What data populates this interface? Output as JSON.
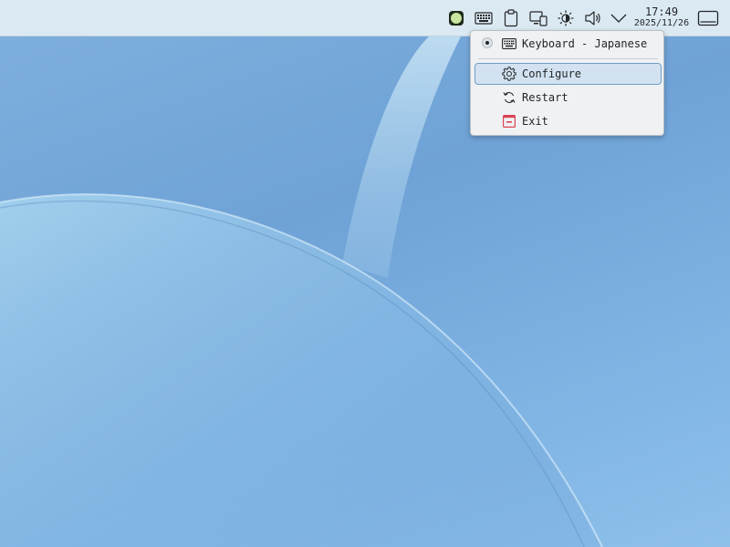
{
  "panel": {
    "tray_icons": [
      "input-method-icon",
      "keyboard-icon",
      "clipboard-icon",
      "display-configuration-icon",
      "brightness-icon",
      "volume-icon",
      "expand-tray-icon"
    ],
    "clock": {
      "time": "17:49",
      "date": "2025/11/26"
    },
    "show_desktop_icon": "show-desktop-icon"
  },
  "menu": {
    "items": [
      {
        "label": "Keyboard - Japanese",
        "icon": "keyboard-icon",
        "type": "radio",
        "checked": true
      },
      {
        "label": "Configure",
        "icon": "gear-icon",
        "highlighted": true
      },
      {
        "label": "Restart",
        "icon": "restart-icon"
      },
      {
        "label": "Exit",
        "icon": "exit-icon",
        "icon_color": "#da4453"
      }
    ]
  },
  "colors": {
    "panel_bg": "#dbe9f2",
    "menu_bg": "#eff1f3",
    "highlight_bg": "#d2e2f0",
    "highlight_border": "#6f9fc8",
    "exit_red": "#da4453"
  }
}
